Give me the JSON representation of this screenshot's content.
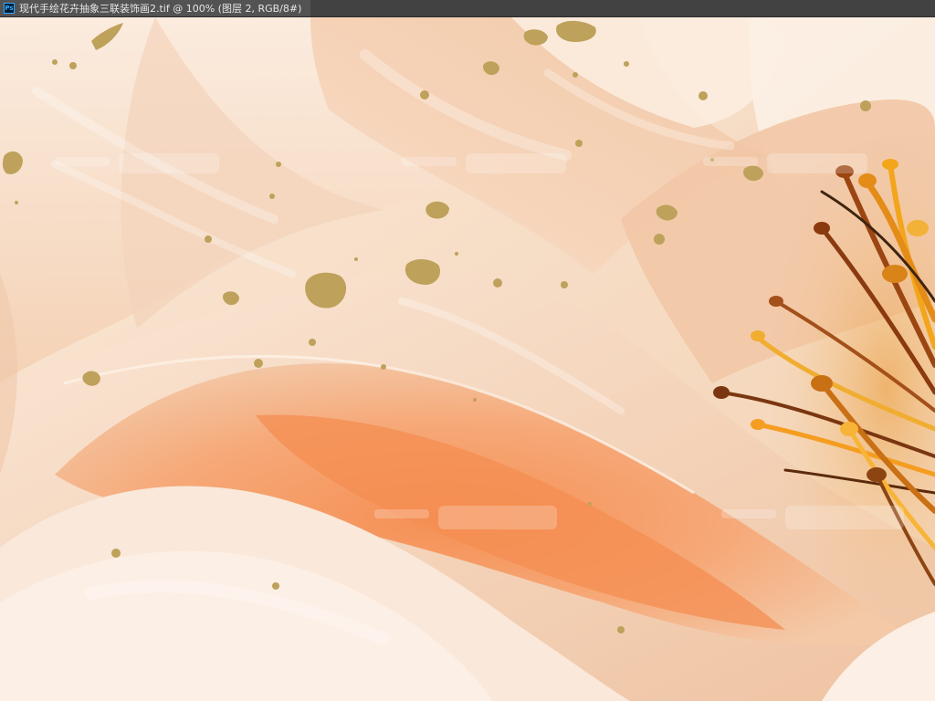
{
  "window": {
    "tab_title": "现代手绘花卉抽象三联装饰画2.tif @ 100% (图层 2, RGB/8#)",
    "app_icon": "photoshop-icon"
  },
  "canvas": {
    "content": "painting",
    "palette": {
      "petal_light": "#f9e6d2",
      "petal_peach": "#f3c7a4",
      "petal_orange": "#f49b5e",
      "stamen_brown": "#8b3c10",
      "stamen_yellow": "#f6a61a",
      "gold_fleck": "#bfa35a"
    }
  }
}
